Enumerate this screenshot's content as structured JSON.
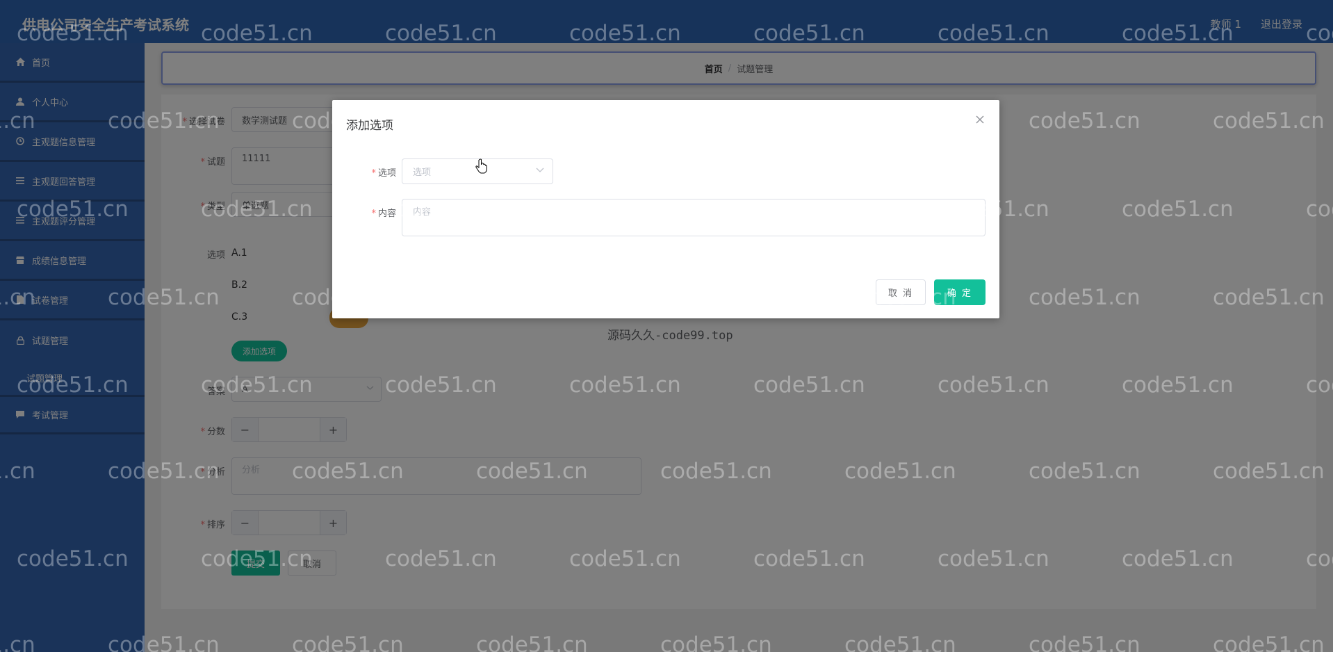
{
  "header": {
    "title": "供电公司安全生产考试系统",
    "user": "教师 1",
    "logout": "退出登录"
  },
  "sidebar": {
    "items": [
      {
        "label": "首页",
        "icon": "home-icon"
      },
      {
        "label": "个人中心",
        "icon": "user-icon"
      },
      {
        "label": "主观题信息管理",
        "icon": "clock-icon"
      },
      {
        "label": "主观题回答管理",
        "icon": "list-icon"
      },
      {
        "label": "主观题评分管理",
        "icon": "list-icon"
      },
      {
        "label": "成绩信息管理",
        "icon": "shop-icon"
      },
      {
        "label": "试卷管理",
        "icon": "document-icon"
      },
      {
        "label": "试题管理",
        "icon": "lock-icon"
      },
      {
        "label": "试题管理",
        "icon": ""
      },
      {
        "label": "考试管理",
        "icon": "chat-icon"
      }
    ]
  },
  "breadcrumb": {
    "home": "首页",
    "separator": "/",
    "current": "试题管理"
  },
  "form": {
    "paper_label": "选择试卷",
    "paper_value": "数学测试题",
    "question_label": "试题",
    "question_value": "11111",
    "type_label": "类型",
    "type_value": "单选题",
    "options_label": "选项",
    "options": [
      "A.1",
      "B.2",
      "C.3"
    ],
    "add_option_button": "添加选项",
    "answer_label": "答案",
    "answer_value": "A",
    "score_label": "分数",
    "analysis_label": "分析",
    "analysis_placeholder": "分析",
    "sort_label": "排序",
    "submit_button": "提交",
    "cancel_button": "取消"
  },
  "dialog": {
    "title": "添加选项",
    "option_label": "选项",
    "option_placeholder": "选项",
    "content_label": "内容",
    "content_placeholder": "内容",
    "cancel": "取 消",
    "confirm": "确 定"
  },
  "caption": "源码久久-code99.top",
  "watermark": "code51.cn",
  "colors": {
    "primary": "#13c09a",
    "header": "#2f67b5",
    "sidebar": "#3567b3",
    "required": "#f56c6c",
    "warning": "#e6a23c"
  }
}
